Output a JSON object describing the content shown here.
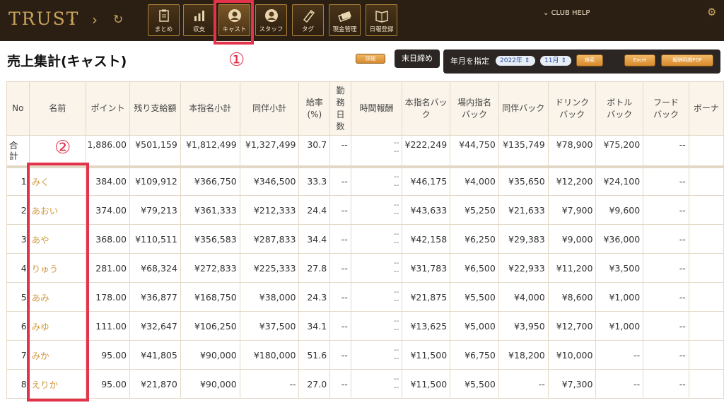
{
  "app": {
    "logo": "TRUST",
    "club": "CLUB HELP"
  },
  "nav": [
    {
      "label": "まとめ",
      "icon": "clipboard-icon",
      "active": false
    },
    {
      "label": "収支",
      "icon": "bar-chart-icon",
      "active": false
    },
    {
      "label": "キャスト",
      "icon": "person-icon",
      "active": true
    },
    {
      "label": "スタッフ",
      "icon": "person-icon",
      "active": false
    },
    {
      "label": "タグ",
      "icon": "tag-icon",
      "active": false
    },
    {
      "label": "現金管理",
      "icon": "cash-icon",
      "active": false
    },
    {
      "label": "日報登録",
      "icon": "book-icon",
      "active": false
    }
  ],
  "page": {
    "title": "売上集計(キャスト)"
  },
  "annotations": {
    "one": "①",
    "two": "②"
  },
  "controls": {
    "detail": "詳細",
    "closing": "末日締め",
    "ym_label": "年月を指定",
    "year": "2022年",
    "month": "11月",
    "search": "検索",
    "excel": "Excel",
    "pdf": "報酬明細PDF"
  },
  "table": {
    "headers": [
      "No",
      "名前",
      "ポイント",
      "残り支給額",
      "本指名小計",
      "同伴小計",
      "給率\n(%)",
      "勤\n務\n日\n数",
      "時間報酬",
      "本指名バッ\nク",
      "場内指名\nバック",
      "同伴バック",
      "ドリンク\nバック",
      "ボトル\nバック",
      "フード\nバック",
      "ボーナ"
    ],
    "total": {
      "label": "合\n計",
      "point": "1,886.00",
      "remain": "¥501,159",
      "honshimei": "¥1,812,499",
      "douhan": "¥1,327,499",
      "rate": "30.7",
      "days": "--",
      "time": "--\n--",
      "b_hon": "¥222,249",
      "b_jounai": "¥44,750",
      "b_douhan": "¥135,749",
      "b_drink": "¥78,900",
      "b_bottle": "¥75,200",
      "b_food": "--"
    },
    "rows": [
      {
        "no": "1",
        "name": "みく",
        "point": "384.00",
        "remain": "¥109,912",
        "honshimei": "¥366,750",
        "douhan": "¥346,500",
        "rate": "33.3",
        "days": "--",
        "time": "--\n--",
        "b_hon": "¥46,175",
        "b_jounai": "¥4,000",
        "b_douhan": "¥35,650",
        "b_drink": "¥12,200",
        "b_bottle": "¥24,100",
        "b_food": "--"
      },
      {
        "no": "2",
        "name": "あおい",
        "point": "374.00",
        "remain": "¥79,213",
        "honshimei": "¥361,333",
        "douhan": "¥212,333",
        "rate": "24.4",
        "days": "--",
        "time": "--\n--",
        "b_hon": "¥43,633",
        "b_jounai": "¥5,250",
        "b_douhan": "¥21,633",
        "b_drink": "¥7,900",
        "b_bottle": "¥9,600",
        "b_food": "--"
      },
      {
        "no": "3",
        "name": "あや",
        "point": "368.00",
        "remain": "¥110,511",
        "honshimei": "¥356,583",
        "douhan": "¥287,833",
        "rate": "34.4",
        "days": "--",
        "time": "--\n--",
        "b_hon": "¥42,158",
        "b_jounai": "¥6,250",
        "b_douhan": "¥29,383",
        "b_drink": "¥9,000",
        "b_bottle": "¥36,000",
        "b_food": "--"
      },
      {
        "no": "4",
        "name": "りゅう",
        "point": "281.00",
        "remain": "¥68,324",
        "honshimei": "¥272,833",
        "douhan": "¥225,333",
        "rate": "27.8",
        "days": "--",
        "time": "--\n--",
        "b_hon": "¥31,783",
        "b_jounai": "¥6,500",
        "b_douhan": "¥22,933",
        "b_drink": "¥11,200",
        "b_bottle": "¥3,500",
        "b_food": "--"
      },
      {
        "no": "5",
        "name": "あみ",
        "point": "178.00",
        "remain": "¥36,877",
        "honshimei": "¥168,750",
        "douhan": "¥38,000",
        "rate": "24.3",
        "days": "--",
        "time": "--\n--",
        "b_hon": "¥21,875",
        "b_jounai": "¥5,500",
        "b_douhan": "¥4,000",
        "b_drink": "¥8,600",
        "b_bottle": "¥1,000",
        "b_food": "--"
      },
      {
        "no": "6",
        "name": "みゆ",
        "point": "111.00",
        "remain": "¥32,647",
        "honshimei": "¥106,250",
        "douhan": "¥37,500",
        "rate": "34.1",
        "days": "--",
        "time": "--\n--",
        "b_hon": "¥13,625",
        "b_jounai": "¥5,000",
        "b_douhan": "¥3,950",
        "b_drink": "¥12,700",
        "b_bottle": "¥1,000",
        "b_food": "--"
      },
      {
        "no": "7",
        "name": "みか",
        "point": "95.00",
        "remain": "¥41,805",
        "honshimei": "¥90,000",
        "douhan": "¥180,000",
        "rate": "51.6",
        "days": "--",
        "time": "--\n--",
        "b_hon": "¥11,500",
        "b_jounai": "¥6,750",
        "b_douhan": "¥18,200",
        "b_drink": "¥10,000",
        "b_bottle": "--",
        "b_food": "--"
      },
      {
        "no": "8",
        "name": "えりか",
        "point": "95.00",
        "remain": "¥21,870",
        "honshimei": "¥90,000",
        "douhan": "--",
        "rate": "27.0",
        "days": "--",
        "time": "--\n--",
        "b_hon": "¥11,500",
        "b_jounai": "¥5,500",
        "b_douhan": "--",
        "b_drink": "¥7,300",
        "b_bottle": "--",
        "b_food": "--"
      }
    ]
  }
}
